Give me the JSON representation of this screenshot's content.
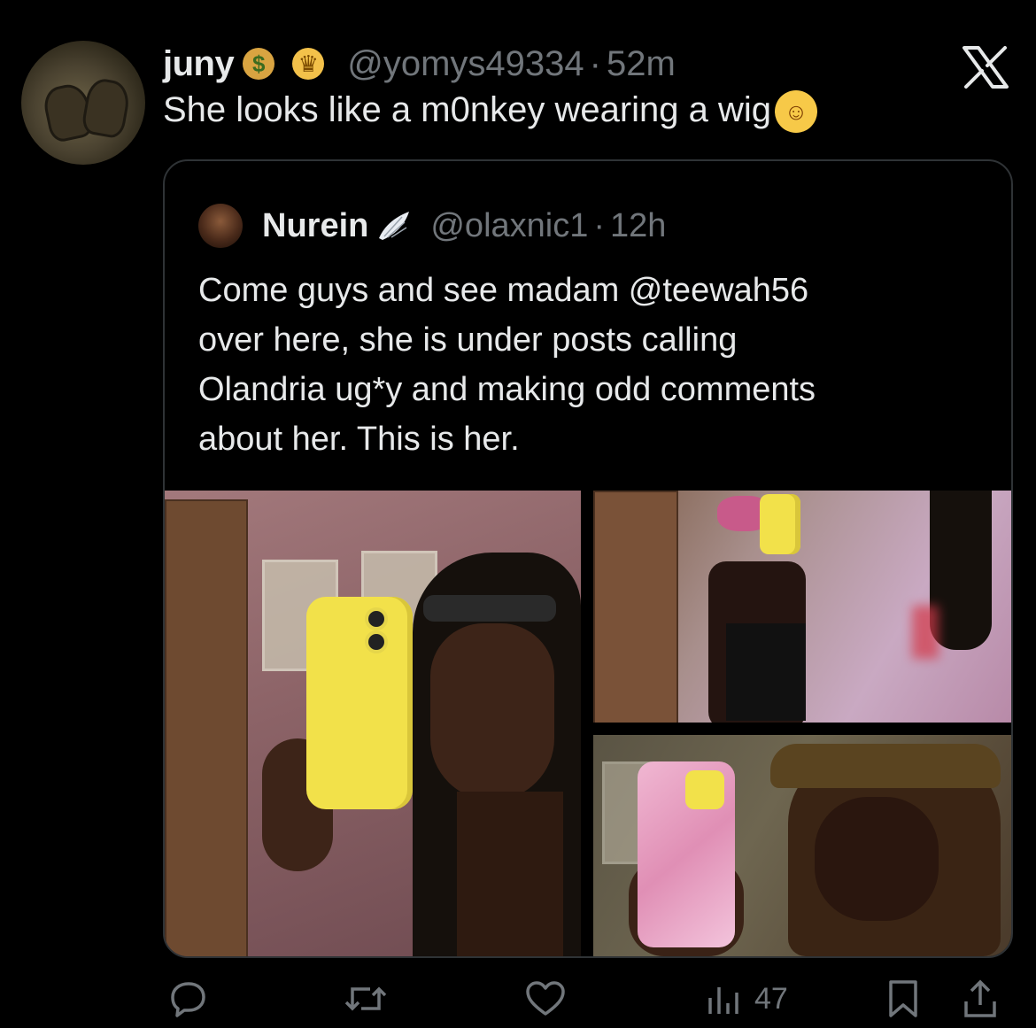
{
  "tweet": {
    "author": {
      "name": "juny",
      "badge_1_icon": "money-bag-icon",
      "badge_2_icon": "princess-icon",
      "handle": "@yomys49334",
      "separator": "·",
      "time": "52m"
    },
    "text": "She looks like a m0nkey wearing a wig",
    "text_emoji_icon": "rolling-on-floor-laughing-icon",
    "platform_icon": "x-logo-icon"
  },
  "quoted_tweet": {
    "author": {
      "name": "Nurein",
      "badge_icon": "wing-icon",
      "handle": "@olaxnic1",
      "separator": "·",
      "time": "12h"
    },
    "text_lines": [
      "Come guys and see madam @teewah56",
      "over here, she is under posts calling",
      "Olandria ug*y and making odd comments",
      "about her. This is her."
    ],
    "media_icons": [
      "photo-yellow-iphone-selfie",
      "photo-mirror-selfie-room",
      "photo-pink-case-selfie"
    ]
  },
  "actions": {
    "reply_icon": "reply-icon",
    "retweet_icon": "retweet-icon",
    "like_icon": "heart-icon",
    "views_icon": "views-icon",
    "views_count": "47",
    "bookmark_icon": "bookmark-icon",
    "share_icon": "share-icon"
  },
  "colors": {
    "background": "#000000",
    "text_primary": "#e7e9ea",
    "text_secondary": "#71767b",
    "border": "#2f3336"
  }
}
